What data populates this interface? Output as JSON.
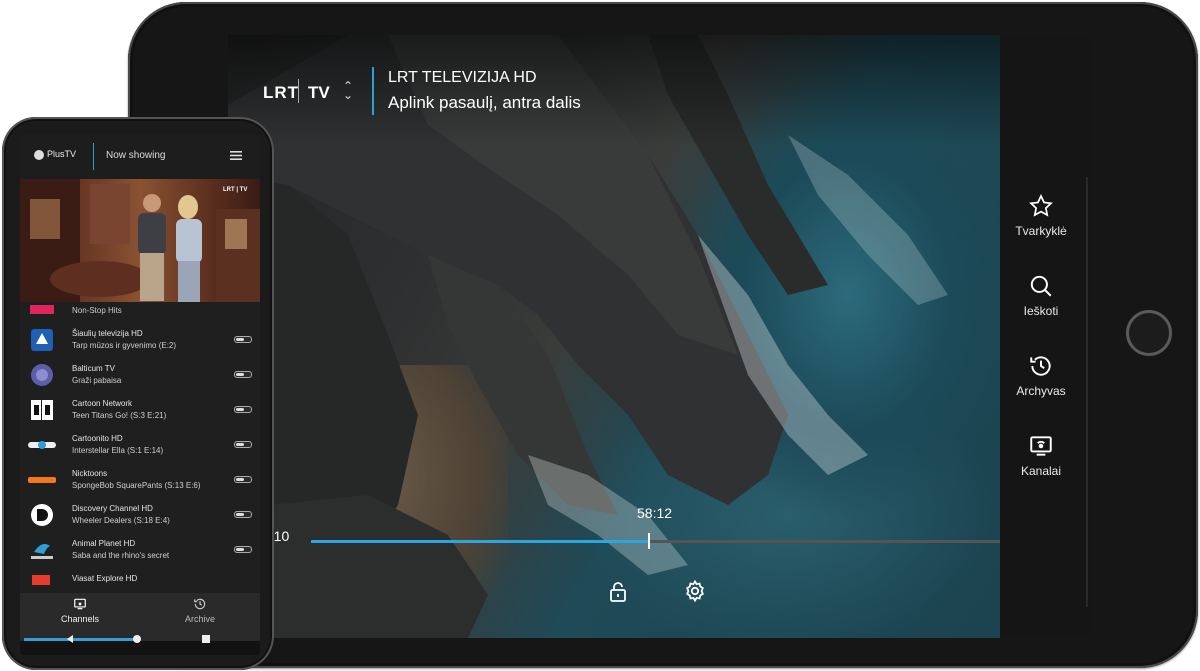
{
  "tablet": {
    "logo_lrt": "LRT",
    "logo_tv": "TV",
    "channel_title": "LRT TELEVIZIJA HD",
    "show_title": "Aplink pasaulį, antra dalis",
    "time_elapsed": "6:10",
    "time_marker": "58:12",
    "progress": 0.49,
    "sidebar": [
      {
        "label": "Tvarkyklė",
        "icon": "star-icon"
      },
      {
        "label": "Ieškoti",
        "icon": "search-icon"
      },
      {
        "label": "Archyvas",
        "icon": "history-icon"
      },
      {
        "label": "Kanalai",
        "icon": "tv-channels-icon"
      }
    ]
  },
  "phone": {
    "logo": "PlusTV",
    "header_title": "Now showing",
    "video_logo": "LRT | TV",
    "channels": [
      {
        "channel": "",
        "program": "Non-Stop Hits",
        "icon": "hits-logo"
      },
      {
        "channel": "Šiaulių televizija HD",
        "program": "Tarp mūzos ir gyvenimo (E:2)",
        "icon": "siauliu-tv-logo"
      },
      {
        "channel": "Balticum TV",
        "program": "Graži pabaisa",
        "icon": "balticum-logo"
      },
      {
        "channel": "Cartoon Network",
        "program": "Teen Titans Go! (S:3 E:21)",
        "icon": "cartoon-network-logo"
      },
      {
        "channel": "Cartoonito HD",
        "program": "Interstellar Ella (S:1 E:14)",
        "icon": "cartoonito-logo"
      },
      {
        "channel": "Nicktoons",
        "program": "SpongeBob SquarePants (S:13 E:6)",
        "icon": "nicktoons-logo"
      },
      {
        "channel": "Discovery Channel HD",
        "program": "Wheeler Dealers (S:18 E:4)",
        "icon": "discovery-logo"
      },
      {
        "channel": "Animal Planet HD",
        "program": "Saba and the rhino's secret",
        "icon": "animal-planet-logo"
      },
      {
        "channel": "Viasat Explore HD",
        "program": "",
        "icon": "viasat-logo"
      }
    ],
    "tabs": [
      {
        "label": "Channels",
        "active": true
      },
      {
        "label": "Archive",
        "active": false
      }
    ]
  },
  "colors": {
    "accent": "#2aa6e0"
  }
}
